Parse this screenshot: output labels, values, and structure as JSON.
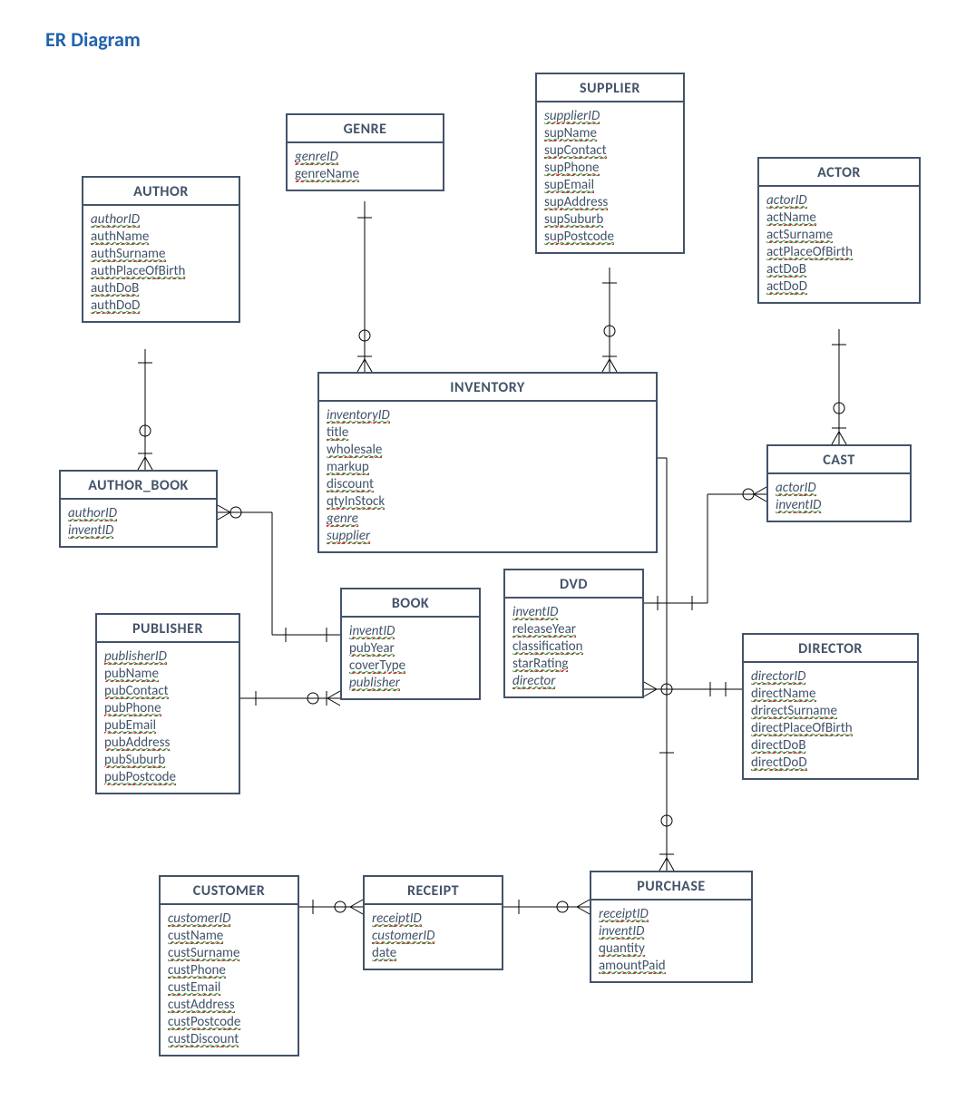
{
  "title": "ER Diagram",
  "entities": {
    "author": {
      "name": "AUTHOR",
      "attrs": [
        {
          "n": "authorID",
          "pk": true
        },
        {
          "n": "authName"
        },
        {
          "n": "authSurname"
        },
        {
          "n": "authPlaceOfBirth"
        },
        {
          "n": "authDoB"
        },
        {
          "n": "authDoD"
        }
      ]
    },
    "genre": {
      "name": "GENRE",
      "attrs": [
        {
          "n": "genreID",
          "pk": true
        },
        {
          "n": "genreName"
        }
      ]
    },
    "supplier": {
      "name": "SUPPLIER",
      "attrs": [
        {
          "n": "supplierID",
          "pk": true
        },
        {
          "n": "supName"
        },
        {
          "n": "supContact"
        },
        {
          "n": "supPhone"
        },
        {
          "n": "supEmail"
        },
        {
          "n": "supAddress"
        },
        {
          "n": "supSuburb"
        },
        {
          "n": "supPostcode"
        }
      ]
    },
    "actor": {
      "name": "ACTOR",
      "attrs": [
        {
          "n": "actorID",
          "pk": true
        },
        {
          "n": "actName"
        },
        {
          "n": "actSurname"
        },
        {
          "n": "actPlaceOfBirth"
        },
        {
          "n": "actDoB"
        },
        {
          "n": "actDoD"
        }
      ]
    },
    "author_book": {
      "name": "AUTHOR_BOOK",
      "attrs": [
        {
          "n": "authorID",
          "pk": true,
          "fk": true
        },
        {
          "n": "inventID",
          "pk": true,
          "fk": true
        }
      ]
    },
    "inventory": {
      "name": "INVENTORY",
      "attrs": [
        {
          "n": "inventoryID",
          "pk": true
        },
        {
          "n": "title"
        },
        {
          "n": "wholesale"
        },
        {
          "n": "markup"
        },
        {
          "n": "discount"
        },
        {
          "n": "qtyInStock"
        },
        {
          "n": "genre",
          "fk": true
        },
        {
          "n": "supplier",
          "fk": true
        }
      ]
    },
    "cast": {
      "name": "CAST",
      "attrs": [
        {
          "n": "actorID",
          "pk": true,
          "fk": true
        },
        {
          "n": "inventID",
          "pk": true,
          "fk": true
        }
      ]
    },
    "publisher": {
      "name": "PUBLISHER",
      "attrs": [
        {
          "n": "publisherID",
          "pk": true
        },
        {
          "n": "pubName"
        },
        {
          "n": "pubContact"
        },
        {
          "n": "pubPhone"
        },
        {
          "n": "pubEmail"
        },
        {
          "n": "pubAddress"
        },
        {
          "n": "pubSuburb"
        },
        {
          "n": "pubPostcode"
        }
      ]
    },
    "book": {
      "name": "BOOK",
      "attrs": [
        {
          "n": "inventID",
          "pk": true,
          "fk": true
        },
        {
          "n": "pubYear"
        },
        {
          "n": "coverType"
        },
        {
          "n": "publisher",
          "fk": true
        }
      ]
    },
    "dvd": {
      "name": "DVD",
      "attrs": [
        {
          "n": "inventID",
          "pk": true,
          "fk": true
        },
        {
          "n": "releaseYear"
        },
        {
          "n": "classification"
        },
        {
          "n": "starRating"
        },
        {
          "n": "director",
          "fk": true
        }
      ]
    },
    "director": {
      "name": "DIRECTOR",
      "attrs": [
        {
          "n": "directorID",
          "pk": true
        },
        {
          "n": "directName"
        },
        {
          "n": "drirectSurname"
        },
        {
          "n": "directPlaceOfBirth"
        },
        {
          "n": "directDoB"
        },
        {
          "n": "directDoD"
        }
      ]
    },
    "customer": {
      "name": "CUSTOMER",
      "attrs": [
        {
          "n": "customerID",
          "pk": true
        },
        {
          "n": "custName"
        },
        {
          "n": "custSurname"
        },
        {
          "n": "custPhone"
        },
        {
          "n": "custEmail"
        },
        {
          "n": "custAddress"
        },
        {
          "n": "custPostcode"
        },
        {
          "n": "custDiscount"
        }
      ]
    },
    "receipt": {
      "name": "RECEIPT",
      "attrs": [
        {
          "n": "receiptID",
          "pk": true
        },
        {
          "n": "customerID",
          "fk": true
        },
        {
          "n": "date"
        }
      ]
    },
    "purchase": {
      "name": "PURCHASE",
      "attrs": [
        {
          "n": "receiptID",
          "pk": true,
          "fk": true
        },
        {
          "n": "inventID",
          "pk": true,
          "fk": true
        },
        {
          "n": "quantity"
        },
        {
          "n": "amountPaid"
        }
      ]
    }
  },
  "relationships": [
    {
      "from": "AUTHOR",
      "to": "AUTHOR_BOOK",
      "card": "1..*"
    },
    {
      "from": "AUTHOR_BOOK",
      "to": "BOOK",
      "card": "*..1"
    },
    {
      "from": "GENRE",
      "to": "INVENTORY",
      "card": "1..*"
    },
    {
      "from": "SUPPLIER",
      "to": "INVENTORY",
      "card": "1..*"
    },
    {
      "from": "ACTOR",
      "to": "CAST",
      "card": "1..*"
    },
    {
      "from": "CAST",
      "to": "DVD",
      "card": "*..1"
    },
    {
      "from": "PUBLISHER",
      "to": "BOOK",
      "card": "1..*"
    },
    {
      "from": "DVD",
      "to": "DIRECTOR",
      "card": "*..1"
    },
    {
      "from": "INVENTORY",
      "to": "PURCHASE",
      "card": "1..*"
    },
    {
      "from": "DVD",
      "to": "INVENTORY",
      "card": "isa"
    },
    {
      "from": "BOOK",
      "to": "INVENTORY",
      "card": "isa"
    },
    {
      "from": "CUSTOMER",
      "to": "RECEIPT",
      "card": "1..*"
    },
    {
      "from": "RECEIPT",
      "to": "PURCHASE",
      "card": "1..*"
    }
  ]
}
